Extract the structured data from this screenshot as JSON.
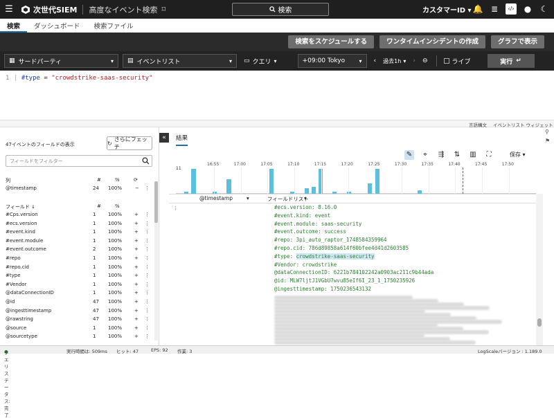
{
  "topbar": {
    "brand": "次世代SIEM",
    "page_name": "高度なイベント検索",
    "search_label": "検索",
    "customer": "カスタマーID"
  },
  "tabs": [
    {
      "label": "検索"
    },
    {
      "label": "ダッシュボード"
    },
    {
      "label": "検索ファイル"
    }
  ],
  "actions": {
    "schedule": "検索をスケジュールする",
    "incident": "ワンタイムインシデントの作成",
    "graph": "グラフで表示"
  },
  "query_bar": {
    "source": "サードパーティ",
    "view": "イベントリスト",
    "mode": "クエリ",
    "timezone": "+09:00 Tokyo",
    "range": "過去1h",
    "live": "ライブ",
    "run": "実行"
  },
  "editor": {
    "line": "1",
    "field": "#type",
    "op": " = ",
    "value": "\"crowdstrike-saas-security\""
  },
  "links": {
    "syntax": "言語構文",
    "widget": "イベントリスト ウィジェット"
  },
  "left": {
    "fields_count": "47イベントのフィールドの表示",
    "fetch": "さらにフェッチ",
    "filter_placeholder": "フィールドをフィルター",
    "cols_label": "列",
    "hash": "#",
    "pct": "%",
    "col_rows": [
      {
        "name": "@timestamp",
        "count": "24",
        "pct": "100%",
        "op": "−"
      }
    ],
    "fields_label": "フィールド ↓",
    "field_rows": [
      {
        "name": "#Cps.version",
        "count": "1",
        "pct": "100%"
      },
      {
        "name": "#ecs.version",
        "count": "1",
        "pct": "100%"
      },
      {
        "name": "#event.kind",
        "count": "1",
        "pct": "100%"
      },
      {
        "name": "#event.module",
        "count": "1",
        "pct": "100%"
      },
      {
        "name": "#event.outcome",
        "count": "2",
        "pct": "100%"
      },
      {
        "name": "#repo",
        "count": "1",
        "pct": "100%"
      },
      {
        "name": "#repo.cid",
        "count": "1",
        "pct": "100%"
      },
      {
        "name": "#type",
        "count": "1",
        "pct": "100%"
      },
      {
        "name": "#Vendor",
        "count": "1",
        "pct": "100%"
      },
      {
        "name": "@dataConnectionID",
        "count": "1",
        "pct": "100%"
      },
      {
        "name": "@id",
        "count": "47",
        "pct": "100%"
      },
      {
        "name": "@ingesttimestamp",
        "count": "47",
        "pct": "100%"
      },
      {
        "name": "@rawstring",
        "count": "47",
        "pct": "100%"
      },
      {
        "name": "@source",
        "count": "1",
        "pct": "100%"
      },
      {
        "name": "@sourcetype",
        "count": "1",
        "pct": "100%"
      }
    ]
  },
  "results": {
    "tab": "結果",
    "save": "保存",
    "ticks": [
      "11",
      "16:55",
      "17:00",
      "17:05",
      "17:10",
      "17:15",
      "17:20",
      "17:25",
      "17:30",
      "17:35",
      "17:40",
      "17:45",
      "17:50"
    ],
    "col_timestamp": "@timestamp",
    "col_fields": "フィールドリスト",
    "lines": [
      "#ecs.version: 8.16.0",
      "#event.kind: event",
      "#event.module: saas-security",
      "#event.outcome: success",
      "#repo: 3pi_auto_raptor_1748584359964",
      "#repo.cid: 786d89858a614f60bfee4d41d2603585",
      "#type: ",
      "#Vendor: crowdstrike",
      "@dataConnectionID: 6221b784102242a0903ac211c9b44ada",
      "@id: MLW7ljtJ1VGbU7wvu85eIf6I_23_1_1750235926",
      "@ingesttimestamp: 1750236543132"
    ],
    "type_highlight": "crowdstrike-saas-security"
  },
  "histogram": {
    "values": [
      0,
      1,
      14,
      0,
      0,
      1,
      0,
      8,
      0,
      0,
      0,
      0,
      0,
      14,
      0,
      0,
      1,
      0,
      3,
      4,
      14,
      0,
      1,
      0,
      1,
      0,
      0,
      6,
      14,
      0,
      0,
      0,
      0,
      0,
      2,
      0,
      0,
      0,
      0,
      0,
      0,
      0,
      0,
      0,
      0,
      0,
      0,
      0,
      0,
      0,
      0
    ]
  },
  "status": {
    "state": "クエリステータス: 完了",
    "time": "実行時間は: 509ms",
    "hits": "ヒット: 47",
    "eps": "EPS: 92",
    "work": "作業: 3",
    "version": "LogScaleバージョン : 1.189.0"
  }
}
